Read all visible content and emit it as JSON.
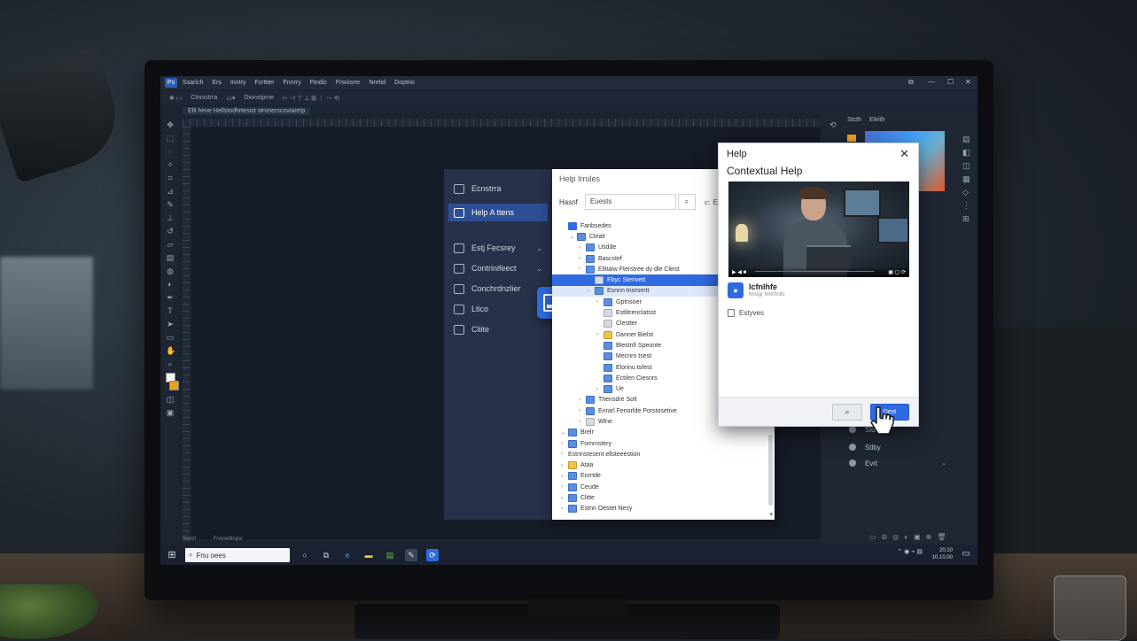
{
  "app": {
    "logo": "Ps",
    "menu": [
      "Ssarich",
      "Ers",
      "Inntry",
      "Fcrttter",
      "Fnnrry",
      "Ftndic",
      "Frsnisrer",
      "Nretid",
      "Doptrio"
    ],
    "options_text": [
      "Clnnistrra",
      "Dionstpme"
    ],
    "document_tab": "Ellt heve Hellstodhrtesist stronerscoviaretp",
    "status_text": "Ssnirl",
    "status_text2": "Fnnnetltnpsi"
  },
  "window_controls": {
    "snap": "⧉",
    "min": "—",
    "max": "☐",
    "close": "✕"
  },
  "right_panel": {
    "tabs": [
      "Stcth",
      "Eleith"
    ],
    "layers": [
      "Sldtt",
      "Stlby",
      "Evrt"
    ]
  },
  "nav_panel": {
    "items": [
      {
        "label": "Ecnstrra",
        "chev": ""
      },
      {
        "label": "Help A ttens",
        "chev": ""
      },
      {
        "label": "Estj Fecsrey",
        "chev": "⌄"
      },
      {
        "label": "Contrinifeect",
        "chev": "⌄"
      },
      {
        "label": "Conchrdnzlier",
        "chev": ""
      },
      {
        "label": "Ltico",
        "chev": ""
      },
      {
        "label": "Cliite",
        "chev": ""
      }
    ]
  },
  "help_browser": {
    "title": "Help Irrules",
    "search_label": "Hasnf",
    "search_value": "Euests",
    "search_extra": "Ec",
    "tree": [
      {
        "arrow": "",
        "icon": "check",
        "label": "Fanbsedes",
        "indent": 0
      },
      {
        "arrow": "⌄",
        "icon": "blue",
        "label": "Clealr",
        "indent": 1
      },
      {
        "arrow": "›",
        "icon": "blue",
        "label": "Usdde",
        "indent": 2
      },
      {
        "arrow": "›",
        "icon": "blue",
        "label": "Bascstef",
        "indent": 2
      },
      {
        "arrow": "›",
        "icon": "blue",
        "label": "Ellitalw Fterstree dy dle Cleist",
        "indent": 2
      },
      {
        "arrow": "›",
        "icon": "gray",
        "label": "Ebyc Stenvett",
        "indent": 3,
        "state": "selected"
      },
      {
        "arrow": "›",
        "icon": "blue",
        "label": "Esnnn tnorsertt",
        "indent": 3,
        "state": "hover"
      },
      {
        "arrow": "›",
        "icon": "blue",
        "label": "Gptnsoer",
        "indent": 4
      },
      {
        "arrow": "",
        "icon": "gray",
        "label": "Estlitrenclatsst",
        "indent": 4
      },
      {
        "arrow": "",
        "icon": "gray",
        "label": "Clestter",
        "indent": 4
      },
      {
        "arrow": "›",
        "icon": "yellow",
        "label": "Danner Bielst",
        "indent": 4
      },
      {
        "arrow": "",
        "icon": "blue",
        "label": "Blestnfi Speonte",
        "indent": 4
      },
      {
        "arrow": "",
        "icon": "blue",
        "label": "Mecnrn tsest",
        "indent": 4
      },
      {
        "arrow": "",
        "icon": "blue",
        "label": "Elorinu tsfest",
        "indent": 4
      },
      {
        "arrow": "",
        "icon": "blue",
        "label": "Ectilen Ciesnrs",
        "indent": 4
      },
      {
        "arrow": "›",
        "icon": "blue",
        "label": "Ue",
        "indent": 4
      },
      {
        "arrow": "›",
        "icon": "blue",
        "label": "Thensdre Solt",
        "indent": 2
      },
      {
        "arrow": "›",
        "icon": "blue",
        "label": "Enrarl Fenorlde Porstosetive",
        "indent": 2
      },
      {
        "arrow": "›",
        "icon": "gray",
        "label": "Wlne",
        "indent": 2
      },
      {
        "arrow": "⌄",
        "icon": "blue",
        "label": "Brelr",
        "indent": 0
      },
      {
        "arrow": "›",
        "icon": "blue",
        "label": "Fommstery",
        "indent": 0
      },
      {
        "arrow": "›",
        "icon": "",
        "label": "Estnnstesent ellsteeestion",
        "indent": 0
      },
      {
        "arrow": "›",
        "icon": "yellow",
        "label": "Ataa",
        "indent": 0
      },
      {
        "arrow": "›",
        "icon": "blue",
        "label": "Enrrtde",
        "indent": 0
      },
      {
        "arrow": "›",
        "icon": "blue",
        "label": "Ceude",
        "indent": 0
      },
      {
        "arrow": "›",
        "icon": "blue",
        "label": "Clitte",
        "indent": 0
      },
      {
        "arrow": "›",
        "icon": "blue",
        "label": "Estnn Oestet Nesy",
        "indent": 0
      }
    ]
  },
  "dialog": {
    "title": "Help",
    "subtitle": "Contextual Help",
    "close": "✕",
    "video_controls_left": "▶ ◀ ■",
    "video_controls_right": "▣ ▢ ⟳",
    "video_progress": 0.32,
    "article_title": "Icfnlhfe",
    "article_sub": "Nnsgr Imlrrtnlts",
    "related": "Estyves",
    "search_button": "⌕",
    "ok_button": "Dest"
  },
  "taskbar": {
    "search_placeholder": "Fnu oees",
    "clock_time": "20:10",
    "clock_date": "10.10.00",
    "tray": "⌃ ◉ ⌁ ▤"
  },
  "colors": {
    "accent": "#2f6ae0",
    "app_bg": "#1c2331",
    "nav_panel_bg": "#27324a"
  }
}
